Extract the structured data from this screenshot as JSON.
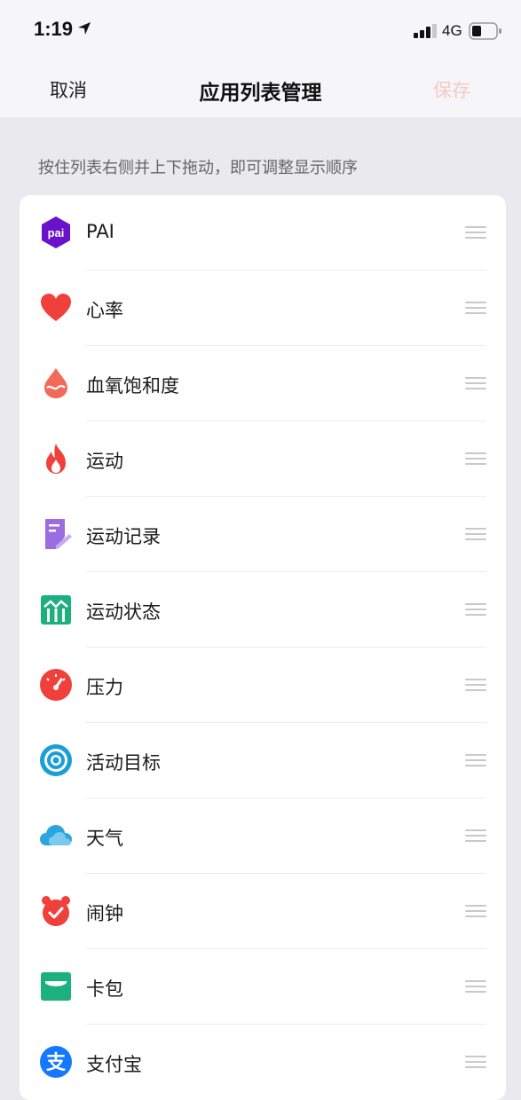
{
  "status_bar": {
    "time": "1:19",
    "network": "4G"
  },
  "nav": {
    "cancel": "取消",
    "title": "应用列表管理",
    "save": "保存"
  },
  "hint": "按住列表右侧并上下拖动，即可调整显示顺序",
  "apps": [
    {
      "label": "PAI",
      "icon": "pai-icon",
      "icon_text": "pai",
      "color": "#6a11cb"
    },
    {
      "label": "心率",
      "icon": "heart-icon",
      "color": "#f0403c"
    },
    {
      "label": "血氧饱和度",
      "icon": "blood-drop-icon",
      "color": "#f26a5a"
    },
    {
      "label": "运动",
      "icon": "flame-icon",
      "color": "#f0403c"
    },
    {
      "label": "运动记录",
      "icon": "workout-log-icon",
      "color": "#9b6de0"
    },
    {
      "label": "运动状态",
      "icon": "sport-status-icon",
      "color": "#1db07f"
    },
    {
      "label": "压力",
      "icon": "gauge-icon",
      "color": "#f0403c"
    },
    {
      "label": "活动目标",
      "icon": "target-icon",
      "color": "#1a9ed8"
    },
    {
      "label": "天气",
      "icon": "cloud-icon",
      "color": "#2aa5e0"
    },
    {
      "label": "闹钟",
      "icon": "alarm-clock-icon",
      "color": "#f0403c"
    },
    {
      "label": "卡包",
      "icon": "wallet-icon",
      "color": "#1db07f"
    },
    {
      "label": "支付宝",
      "icon": "alipay-icon",
      "icon_text": "支",
      "color": "#1677ff"
    }
  ]
}
